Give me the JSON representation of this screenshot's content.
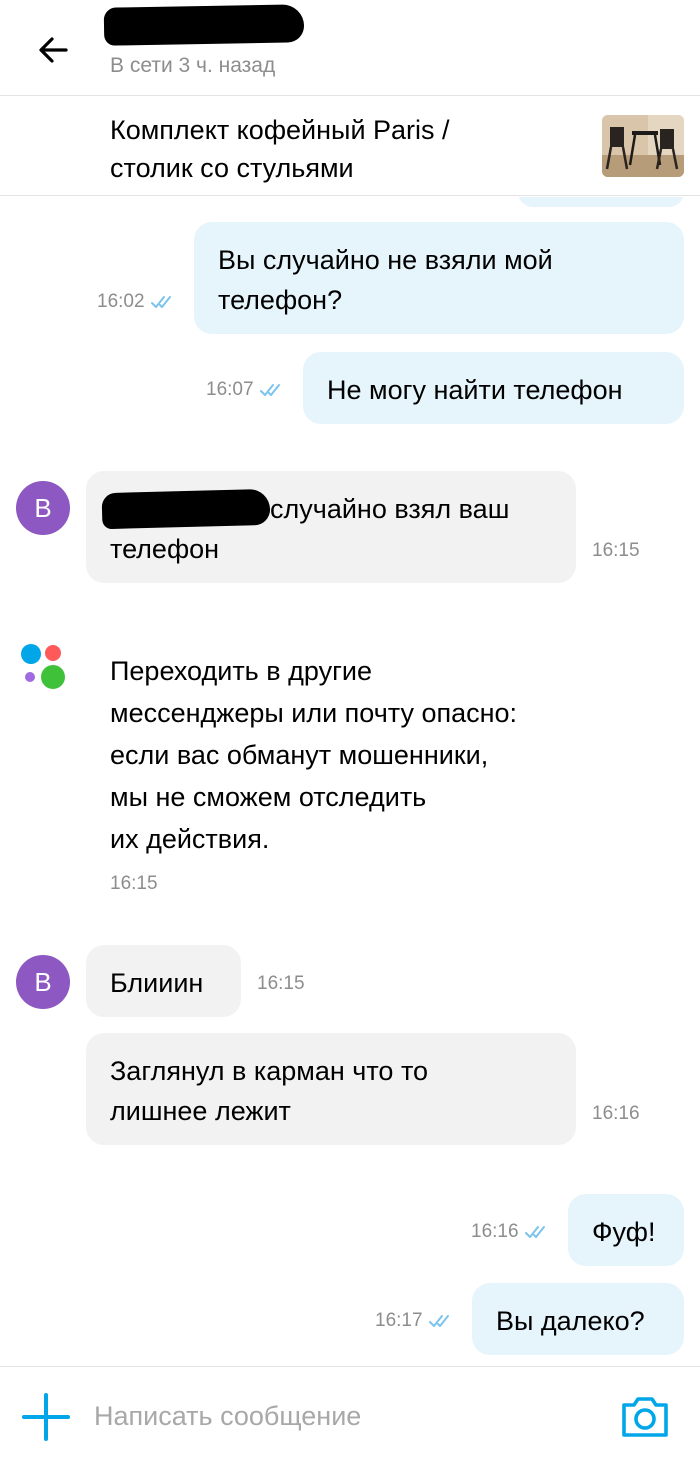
{
  "header": {
    "contact_status": "В сети 3 ч. назад"
  },
  "listing": {
    "title_line1": "Комплект кофейный Paris /",
    "title_line2": "столик со стульями"
  },
  "messages": {
    "m1": {
      "line1": "Вы случайно не взяли мой",
      "line2": "телефон?",
      "time": "16:02"
    },
    "m2": {
      "text": "Не могу найти телефон",
      "time": "16:07"
    },
    "m3": {
      "avatar": "В",
      "line1": "случайно взял ваш",
      "line2": "телефон",
      "time": "16:15"
    },
    "system": {
      "lines": [
        "Переходить в другие",
        "мессенджеры или почту опасно:",
        "если вас обманут мошенники,",
        "мы не сможем отследить",
        "их действия."
      ],
      "time": "16:15"
    },
    "m4": {
      "avatar": "В",
      "text": "Блииин",
      "time": "16:15"
    },
    "m5": {
      "line1": "Заглянул в карман что то",
      "line2": "лишнее лежит",
      "time": "16:16"
    },
    "m6": {
      "text": "Фуф!",
      "time": "16:16"
    },
    "m7": {
      "text": "Вы далеко?",
      "time": "16:17"
    }
  },
  "composer": {
    "placeholder": "Написать сообщение"
  },
  "colors": {
    "outgoing_bubble": "#e6f4fb",
    "incoming_bubble": "#f2f2f2",
    "avatar": "#8d58c2",
    "accent": "#00a6e8",
    "read_ticks": "#7cc4ec"
  },
  "icons": {
    "back": "arrow-left-icon",
    "read_status": "double-check-icon",
    "brand": "avito-dots-icon",
    "attach": "plus-icon",
    "camera": "camera-icon"
  }
}
